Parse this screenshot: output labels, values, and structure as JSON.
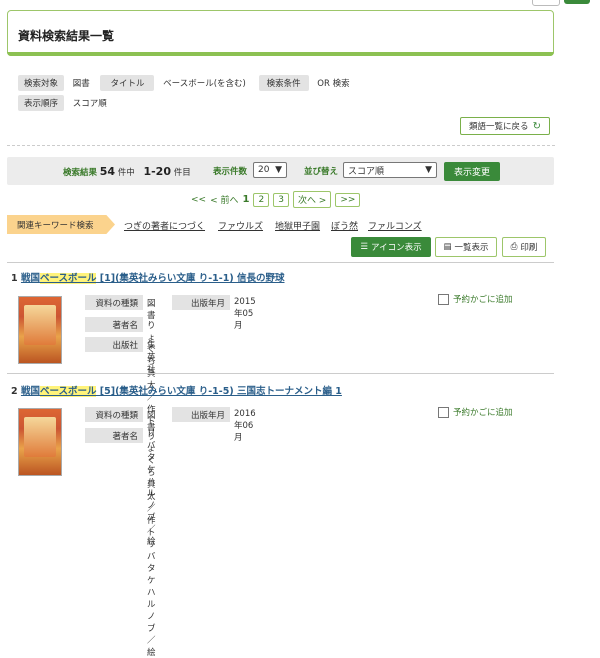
{
  "header": {
    "title": "資料検索結果一覧"
  },
  "conditions": {
    "target_label": "検索対象",
    "target_value": "図書",
    "title_label": "タイトル",
    "title_value": "ベースボール(を含む)",
    "cond_label": "検索条件",
    "cond_value": "OR 検索",
    "order_label": "表示順序",
    "order_value": "スコア順"
  },
  "back_button": {
    "label": "類語一覧に戻る"
  },
  "results_bar": {
    "result_label": "検索結果",
    "total": "54",
    "total_suffix": "件中",
    "range": "1-20",
    "range_suffix": "件目",
    "per_page_label": "表示件数",
    "per_page": "20",
    "sort_label": "並び替え",
    "sort_value": "スコア順",
    "change_button": "表示変更"
  },
  "pagination": {
    "first": "<<",
    "prev": "< 前へ",
    "current": "1",
    "pages": [
      "2",
      "3"
    ],
    "next": "次へ >",
    "last": ">>"
  },
  "keywords": {
    "label": "関連キーワード検索",
    "items": [
      "つぎの著者につづく",
      "ファウルズ",
      "地獄甲子園",
      "ぼう然",
      "ファルコンズ"
    ]
  },
  "view_buttons": {
    "icon": "アイコン表示",
    "list": "一覧表示",
    "print": "印刷"
  },
  "results": [
    {
      "num": "1",
      "title_pre": "戦国",
      "title_hl": "ベースボール",
      "title_post": " [1](集英社みらい文庫 り-1-1) 信長の野球",
      "type_label": "資料の種類",
      "type": "図書",
      "date_label": "出版年月",
      "date": "2015年05月",
      "author_label": "著者名",
      "author": "りょくち真太／作 トリバタケハルノブ／絵",
      "publisher_label": "出版社",
      "publisher": "集英社",
      "cart": "予約かごに追加"
    },
    {
      "num": "2",
      "title_pre": "戦国",
      "title_hl": "ベースボール",
      "title_post": " [5](集英社みらい文庫 り-1-5) 三国志トーナメント編 1",
      "type_label": "資料の種類",
      "type": "図書",
      "date_label": "出版年月",
      "date": "2016年06月",
      "author_label": "著者名",
      "author": "りょくち真太／作 トリバタケハルノブ／絵",
      "cart": "予約かごに追加"
    }
  ],
  "colors": {
    "accent": "#3a8a3a",
    "border": "#9dc66a",
    "highlight": "#fff37a",
    "keyword_label": "#fbd38d"
  }
}
